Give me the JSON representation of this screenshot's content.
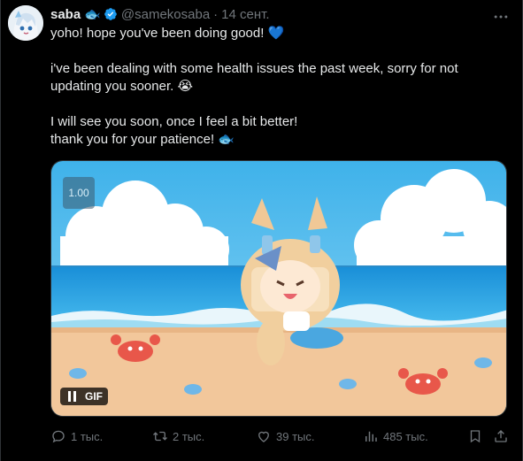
{
  "author": {
    "name": "saba",
    "name_emoji": "🐟",
    "handle": "@samekosaba",
    "separator": "·",
    "date": "14 сент."
  },
  "post": {
    "line1": "yoho! hope you've been doing good! 💙",
    "line2": "i've been dealing with some health issues the past week, sorry for not updating you sooner. 😭",
    "line3": "I will see you soon, once I feel a bit better!",
    "line4": "thank you for your patience! 🐟"
  },
  "media": {
    "speed_label": "1.00",
    "type_label": "GIF"
  },
  "actions": {
    "replies": "1 тыс.",
    "reposts": "2 тыс.",
    "likes": "39 тыс.",
    "views": "485 тыс."
  },
  "colors": {
    "background": "#000000",
    "text": "#e7e9ea",
    "muted": "#71767b",
    "verified": "#1d9bf0"
  }
}
